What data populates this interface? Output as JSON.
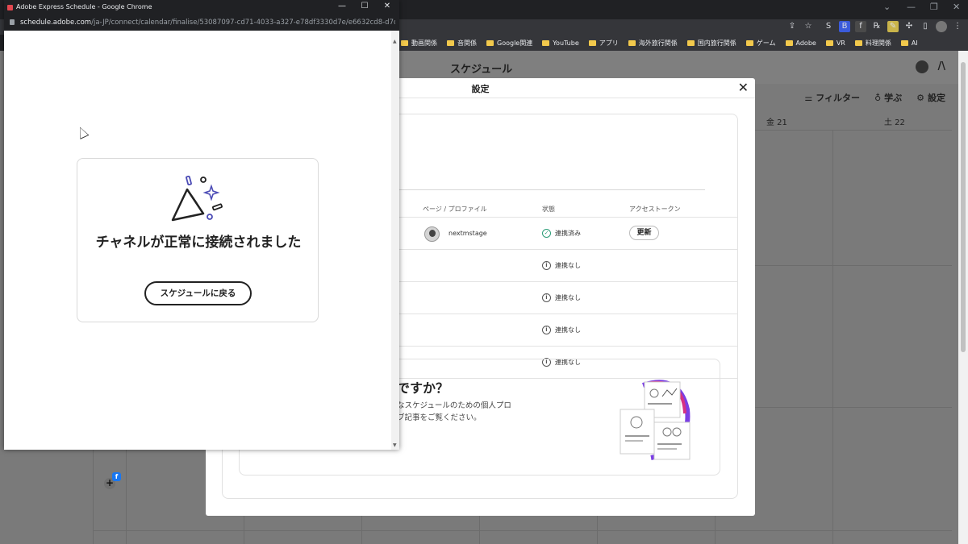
{
  "popup_window": {
    "title": "Adobe Express Schedule - Google Chrome",
    "url_host": "schedule.adobe.com",
    "url_path": "/ja-JP/connect/calendar/finalise/53087097-cd71-4033-a327-e78df3330d7e/e6632cd8-d7d9-4ca3...",
    "success_message": "チャネルが正常に接続されました",
    "back_button": "スケジュールに戻る",
    "window_controls": {
      "minimize": "—",
      "maximize": "☐",
      "close": "✕"
    }
  },
  "bookmarks": [
    "動画関係",
    "音関係",
    "Google関連",
    "YouTube",
    "アプリ",
    "海外旅行関係",
    "国内旅行関係",
    "ゲーム",
    "Adobe",
    "VR",
    "料理関係",
    "AI"
  ],
  "app": {
    "page_title": "スケジュール",
    "toolbar": {
      "filter": "フィルター",
      "learn": "学ぶ",
      "settings": "設定"
    },
    "calendar_days": [
      "金 21",
      "土 22"
    ]
  },
  "settings_modal": {
    "title": "設定",
    "close": "✕",
    "table_headers": {
      "profile": "ページ / プロファイル",
      "status": "状態",
      "token": "アクセストークン"
    },
    "rows": [
      {
        "profile": "nextmstage",
        "status": "連携済み",
        "status_kind": "connected",
        "token_button": "更新"
      },
      {
        "profile": "",
        "status": "連携なし",
        "status_kind": "none",
        "token_button": ""
      },
      {
        "profile": "",
        "status": "連携なし",
        "status_kind": "none",
        "token_button": ""
      },
      {
        "profile": "",
        "status": "連携なし",
        "status_kind": "none",
        "token_button": ""
      },
      {
        "profile": "",
        "status": "連携なし",
        "status_kind": "none",
        "token_button": ""
      }
    ],
    "promo": {
      "title": "ですか？",
      "text_line1": "なスケジュールのための個人プロ",
      "text_line2": "ブ記事をご覧ください。"
    }
  },
  "colors": {
    "connected": "#2d9d78",
    "accent_pink": "#d63384",
    "accent_purple": "#7b3fe4"
  }
}
